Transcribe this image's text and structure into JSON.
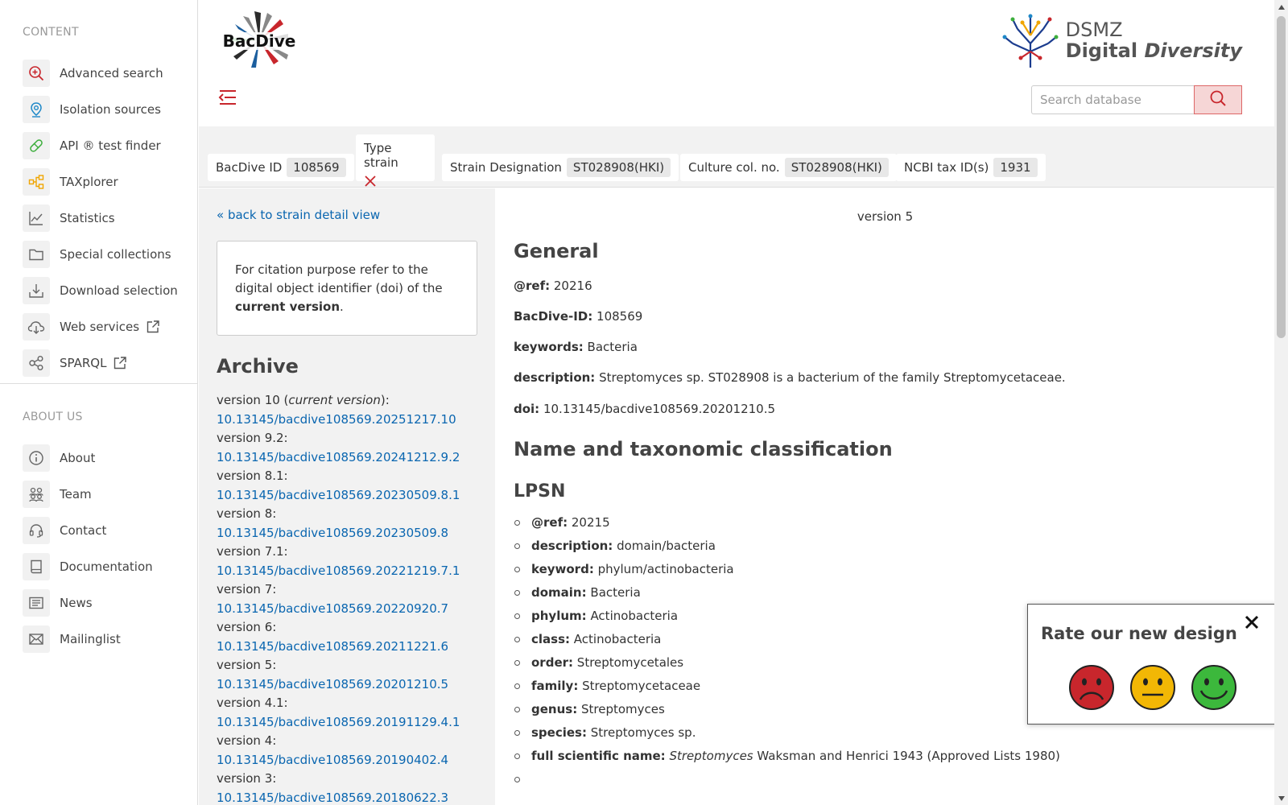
{
  "sidebar": {
    "content_title": "CONTENT",
    "content_items": [
      {
        "label": "Advanced search",
        "icon": "search-plus-icon",
        "external": false
      },
      {
        "label": "Isolation sources",
        "icon": "map-pin-icon",
        "external": false
      },
      {
        "label": "API ® test finder",
        "icon": "pill-icon",
        "external": false
      },
      {
        "label": "TAXplorer",
        "icon": "hierarchy-icon",
        "external": false
      },
      {
        "label": "Statistics",
        "icon": "chart-line-icon",
        "external": false
      },
      {
        "label": "Special collections",
        "icon": "folder-icon",
        "external": false
      },
      {
        "label": "Download selection",
        "icon": "download-icon",
        "external": false
      },
      {
        "label": "Web services",
        "icon": "cloud-download-icon",
        "external": true
      },
      {
        "label": "SPARQL",
        "icon": "share-nodes-icon",
        "external": true
      }
    ],
    "about_title": "ABOUT US",
    "about_items": [
      {
        "label": "About",
        "icon": "info-icon"
      },
      {
        "label": "Team",
        "icon": "team-icon"
      },
      {
        "label": "Contact",
        "icon": "headset-icon"
      },
      {
        "label": "Documentation",
        "icon": "book-icon"
      },
      {
        "label": "News",
        "icon": "newspaper-icon"
      },
      {
        "label": "Mailinglist",
        "icon": "envelope-icon"
      }
    ]
  },
  "header": {
    "logo_text": "BacDive",
    "dsmz_top": "DSMZ",
    "dsmz_bottom_1": "Digital",
    "dsmz_bottom_2": "Diversity",
    "search_placeholder": "Search database"
  },
  "infobar": {
    "bacdive_id_label": "BacDive ID",
    "bacdive_id_value": "108569",
    "type_strain_label": "Type strain",
    "strain_designation_label": "Strain Designation",
    "strain_designation_value": "ST028908(HKI)",
    "culture_col_label": "Culture col. no.",
    "culture_col_value": "ST028908(HKI)",
    "ncbi_label": "NCBI tax ID(s)",
    "ncbi_value": "1931"
  },
  "left": {
    "back_link": "« back to strain detail view",
    "cite_pre": "For citation purpose refer to the digital object identifier (doi) of the ",
    "cite_bold": "current version",
    "cite_post": ".",
    "archive_title": "Archive",
    "archive": [
      {
        "version": "version 10 (",
        "current": "current version",
        "suffix": "):",
        "doi": "10.13145/bacdive108569.20251217.10"
      },
      {
        "version": "version 9.2:",
        "doi": "10.13145/bacdive108569.20241212.9.2"
      },
      {
        "version": "version 8.1:",
        "doi": "10.13145/bacdive108569.20230509.8.1"
      },
      {
        "version": "version 8:",
        "doi": "10.13145/bacdive108569.20230509.8"
      },
      {
        "version": "version 7.1:",
        "doi": "10.13145/bacdive108569.20221219.7.1"
      },
      {
        "version": "version 7:",
        "doi": "10.13145/bacdive108569.20220920.7"
      },
      {
        "version": "version 6:",
        "doi": "10.13145/bacdive108569.20211221.6"
      },
      {
        "version": "version 5:",
        "doi": "10.13145/bacdive108569.20201210.5"
      },
      {
        "version": "version 4.1:",
        "doi": "10.13145/bacdive108569.20191129.4.1"
      },
      {
        "version": "version 4:",
        "doi": "10.13145/bacdive108569.20190402.4"
      },
      {
        "version": "version 3:",
        "doi": "10.13145/bacdive108569.20180622.3"
      }
    ]
  },
  "main": {
    "version_label": "version 5",
    "general_title": "General",
    "general": [
      {
        "key": "@ref:",
        "value": "20216"
      },
      {
        "key": "BacDive-ID:",
        "value": "108569"
      },
      {
        "key": "keywords:",
        "value": "Bacteria"
      },
      {
        "key": "description:",
        "value": "Streptomyces sp. ST028908 is a bacterium of the family Streptomycetaceae."
      },
      {
        "key": "doi:",
        "value": "10.13145/bacdive108569.20201210.5"
      }
    ],
    "taxonomy_title": "Name and taxonomic classification",
    "lpsn_title": "LPSN",
    "lpsn": [
      {
        "key": "@ref:",
        "value": "20215"
      },
      {
        "key": "description:",
        "value": "domain/bacteria"
      },
      {
        "key": "keyword:",
        "value": "phylum/actinobacteria"
      },
      {
        "key": "domain:",
        "value": "Bacteria"
      },
      {
        "key": "phylum:",
        "value": "Actinobacteria"
      },
      {
        "key": "class:",
        "value": "Actinobacteria"
      },
      {
        "key": "order:",
        "value": "Streptomycetales"
      },
      {
        "key": "family:",
        "value": "Streptomycetaceae"
      },
      {
        "key": "genus:",
        "value": "Streptomyces"
      },
      {
        "key": "species:",
        "value": "Streptomyces sp."
      }
    ],
    "full_name_key": "full scientific name:",
    "full_name_italic": "Streptomyces",
    "full_name_rest": "Waksman and Henrici 1943 (Approved Lists 1980)"
  },
  "rate": {
    "title": "Rate our new design",
    "faces": [
      "sad-face-icon",
      "neutral-face-icon",
      "happy-face-icon"
    ],
    "colors": {
      "sad": "#c8262c",
      "neutral": "#f2b705",
      "happy": "#3cb83c"
    }
  },
  "colors": {
    "accent": "#c8262c",
    "link": "#0a66b0"
  }
}
